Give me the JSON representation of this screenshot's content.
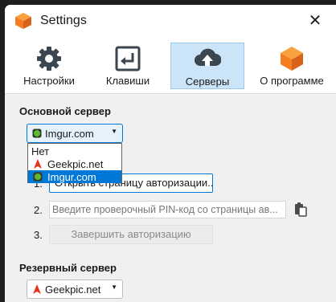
{
  "window": {
    "title": "Settings",
    "close_glyph": "✕"
  },
  "toolbar": {
    "tabs": [
      {
        "label": "Настройки",
        "icon": "gear-icon",
        "active": false
      },
      {
        "label": "Клавиши",
        "icon": "keyboard-enter-icon",
        "active": false
      },
      {
        "label": "Серверы",
        "icon": "cloud-upload-icon",
        "active": true
      },
      {
        "label": "О программе",
        "icon": "app-logo-icon",
        "active": false
      }
    ]
  },
  "primary_server": {
    "heading": "Основной сервер",
    "selected": "Imgur.com",
    "options": [
      {
        "label": "Нет"
      },
      {
        "label": "Geekpic.net",
        "icon": "geekpic-icon"
      },
      {
        "label": "Imgur.com",
        "icon": "imgur-icon",
        "selected": true
      }
    ]
  },
  "auth": {
    "step1_number": "1.",
    "step1_button": "Открыть страницу авторизации...",
    "step2_number": "2.",
    "pin_placeholder": "Введите проверочный PIN-код со страницы ав...",
    "step3_number": "3.",
    "finish_button": "Завершить авторизацию"
  },
  "backup_server": {
    "heading": "Резервный сервер",
    "selected": "Geekpic.net"
  },
  "colors": {
    "accent": "#0078d7",
    "imgur_green": "#5fb82e",
    "geekpic_red": "#e8341c",
    "logo_orange": "#f57c1f"
  }
}
